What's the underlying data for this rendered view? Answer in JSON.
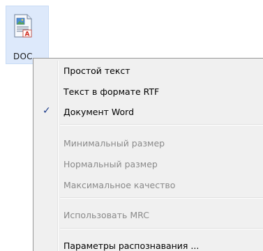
{
  "icon": {
    "name": "doc-file-icon",
    "label": "DOC"
  },
  "menu": {
    "items": [
      {
        "label": "Простой текст",
        "enabled": true,
        "checked": false
      },
      {
        "label": "Текст в формате RTF",
        "enabled": true,
        "checked": false
      },
      {
        "label": "Документ Word",
        "enabled": true,
        "checked": true
      },
      {
        "label": "Минимальный размер",
        "enabled": false,
        "checked": false
      },
      {
        "label": "Нормальный размер",
        "enabled": false,
        "checked": false
      },
      {
        "label": "Максимальное качество",
        "enabled": false,
        "checked": false
      },
      {
        "label": "Использовать MRC",
        "enabled": false,
        "checked": false
      },
      {
        "label": "Параметры распознавания ...",
        "enabled": true,
        "checked": false
      }
    ],
    "check_glyph": "✓"
  },
  "colors": {
    "tile_bg": "#dde9fb",
    "menu_bg": "#f0f0f0",
    "disabled_text": "#8a8a8a",
    "check": "#1d3c8a"
  }
}
